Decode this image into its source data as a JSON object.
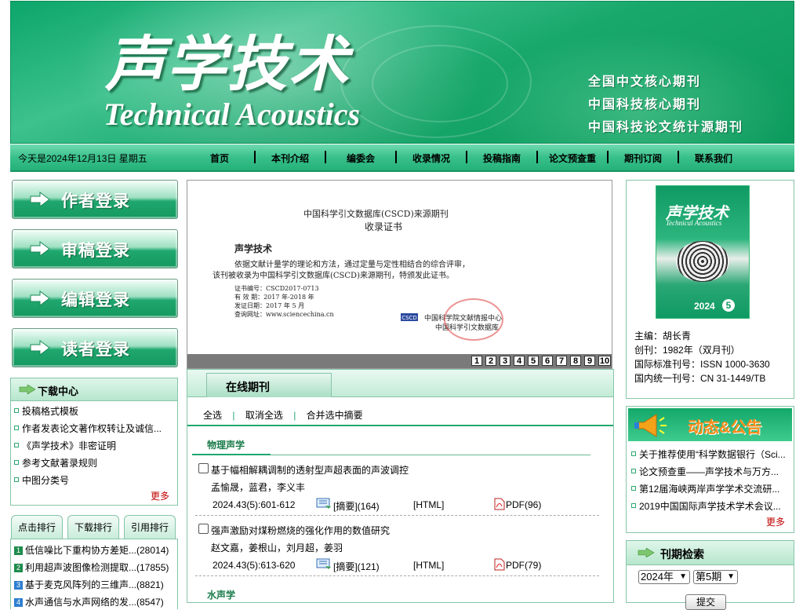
{
  "banner": {
    "title_cn": "声学技术",
    "title_en": "Technical Acoustics",
    "slogans": [
      "全国中文核心期刊",
      "中国科技核心期刊",
      "中国科技论文统计源期刊"
    ]
  },
  "nav": {
    "date": "今天是2024年12月13日 星期五",
    "items": [
      "首页",
      "本刊介绍",
      "编委会",
      "收录情况",
      "投稿指南",
      "论文预查重",
      "期刊订阅",
      "联系我们"
    ]
  },
  "logins": [
    "作者登录",
    "审稿登录",
    "编辑登录",
    "读者登录"
  ],
  "downloads": {
    "title": "下载中心",
    "items": [
      "投稿格式模板",
      "作者发表论文著作权转让及诚信...",
      "《声学技术》非密证明",
      "参考文献著录规则",
      "中图分类号"
    ],
    "more": "更多"
  },
  "rank": {
    "tabs": [
      "点击排行",
      "下载排行",
      "引用排行"
    ],
    "rows": [
      {
        "n": "1",
        "t": "低信噪比下重构协方差矩...(28014)"
      },
      {
        "n": "2",
        "t": "利用超声波图像检测提取...(17855)"
      },
      {
        "n": "3",
        "t": "基于麦克风阵列的三维声...(8821)"
      },
      {
        "n": "4",
        "t": "水声通信与水声网络的发...(8547)"
      }
    ]
  },
  "slide": {
    "cert_title": "中国科学引文数据库(CSCD)来源期刊",
    "cert_sub": "收录证书",
    "journal": "声学技术",
    "body1": "依据文献计量学的理论和方法，通过定量与定性相结合的综合评审，",
    "body2": "该刊被收录为中国科学引文数据库(CSCD)来源期刊，特颁发此证书。",
    "no": "证书编号：CSCD2017-0713",
    "valid": "有 效 期：2017 年-2018 年",
    "date": "发证日期：2017 年 5 月",
    "site": "查询网址：www.sciencechina.cn",
    "issuer1": "中国科学院文献情报中心",
    "issuer2": "中国科学引文数据库",
    "pages": [
      "1",
      "2",
      "3",
      "4",
      "5",
      "6",
      "7",
      "8",
      "9",
      "10"
    ]
  },
  "journal": {
    "tab": "在线期刊",
    "ops": [
      "全选",
      "取消全选",
      "合并选中摘要"
    ],
    "sections": [
      {
        "name": "物理声学"
      },
      {
        "name": "水声学"
      }
    ],
    "articles": [
      {
        "title": "基于幅相解耦调制的透射型声超表面的声波调控",
        "authors": "孟愉晟，蓝君，李义丰",
        "cite": "2024.43(5):601-612",
        "abstract": "[摘要](164)",
        "html": "[HTML]",
        "pdf": "PDF(96)"
      },
      {
        "title": "强声激励对煤粉燃烧的强化作用的数值研究",
        "authors": "赵文嘉，姜根山，刘月超，姜羽",
        "cite": "2024.43(5):613-620",
        "abstract": "[摘要](121)",
        "html": "[HTML]",
        "pdf": "PDF(79)"
      }
    ]
  },
  "info": {
    "editor": "主编：胡长青",
    "founded": "创刊：1982年（双月刊）",
    "issn": "国际标准刊号：ISSN 1000-3630",
    "cn": "国内统一刊号：CN 31-1449/TB",
    "cover_title": "声学技术",
    "cover_en": "Technical Acoustics",
    "cover_year": "2024",
    "cover_issue": "5"
  },
  "news": {
    "banner": "动态&公告",
    "items": [
      "关于推荐使用“科学数据银行（Sci...",
      "论文预查重——声学技术与万方...",
      "第12届海峡两岸声学学术交流研...",
      "2019中国国际声学技术学术会议..."
    ],
    "more": "更多"
  },
  "search": {
    "title": "刊期检索",
    "year": "2024年",
    "issue": "第5期",
    "submit": "提交"
  }
}
